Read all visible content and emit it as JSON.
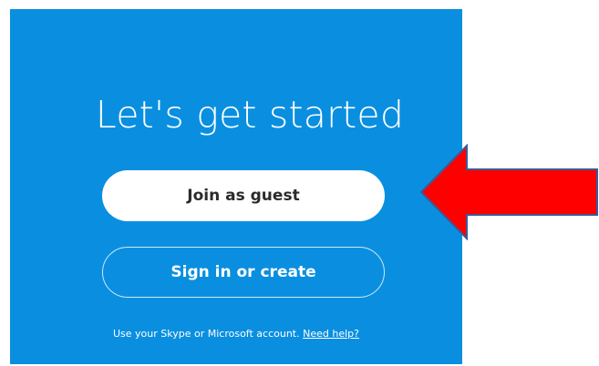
{
  "welcome": {
    "title": "Let's get started",
    "guest_button_label": "Join as guest",
    "signin_button_label": "Sign in or create",
    "account_text": "Use your Skype or Microsoft account.",
    "help_link_label": "Need help?"
  },
  "colors": {
    "panel_background": "#0a8fe0",
    "guest_button_background": "#ffffff",
    "annotation_arrow": "#ff0000"
  },
  "annotation": {
    "arrow_icon": "left-arrow-icon"
  }
}
